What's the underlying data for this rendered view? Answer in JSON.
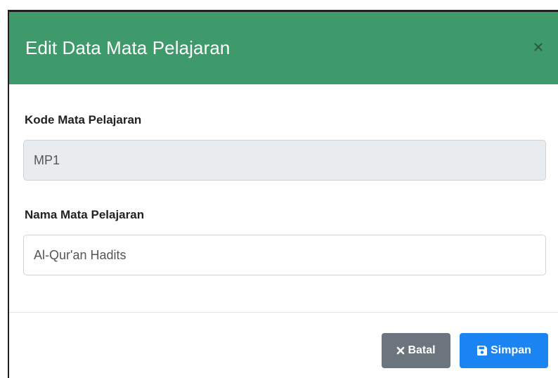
{
  "modal": {
    "title": "Edit Data Mata Pelajaran",
    "close_icon": "close-icon",
    "header_color": "#3f9a6b"
  },
  "form": {
    "kode": {
      "label": "Kode Mata Pelajaran",
      "value": "MP1",
      "readonly": true
    },
    "nama": {
      "label": "Nama Mata Pelajaran",
      "value": "Al-Qur'an Hadits"
    }
  },
  "footer": {
    "cancel_label": "Batal",
    "cancel_icon": "x-icon",
    "cancel_color": "#6c757d",
    "save_label": "Simpan",
    "save_icon": "save-icon",
    "save_color": "#1a85f2"
  }
}
